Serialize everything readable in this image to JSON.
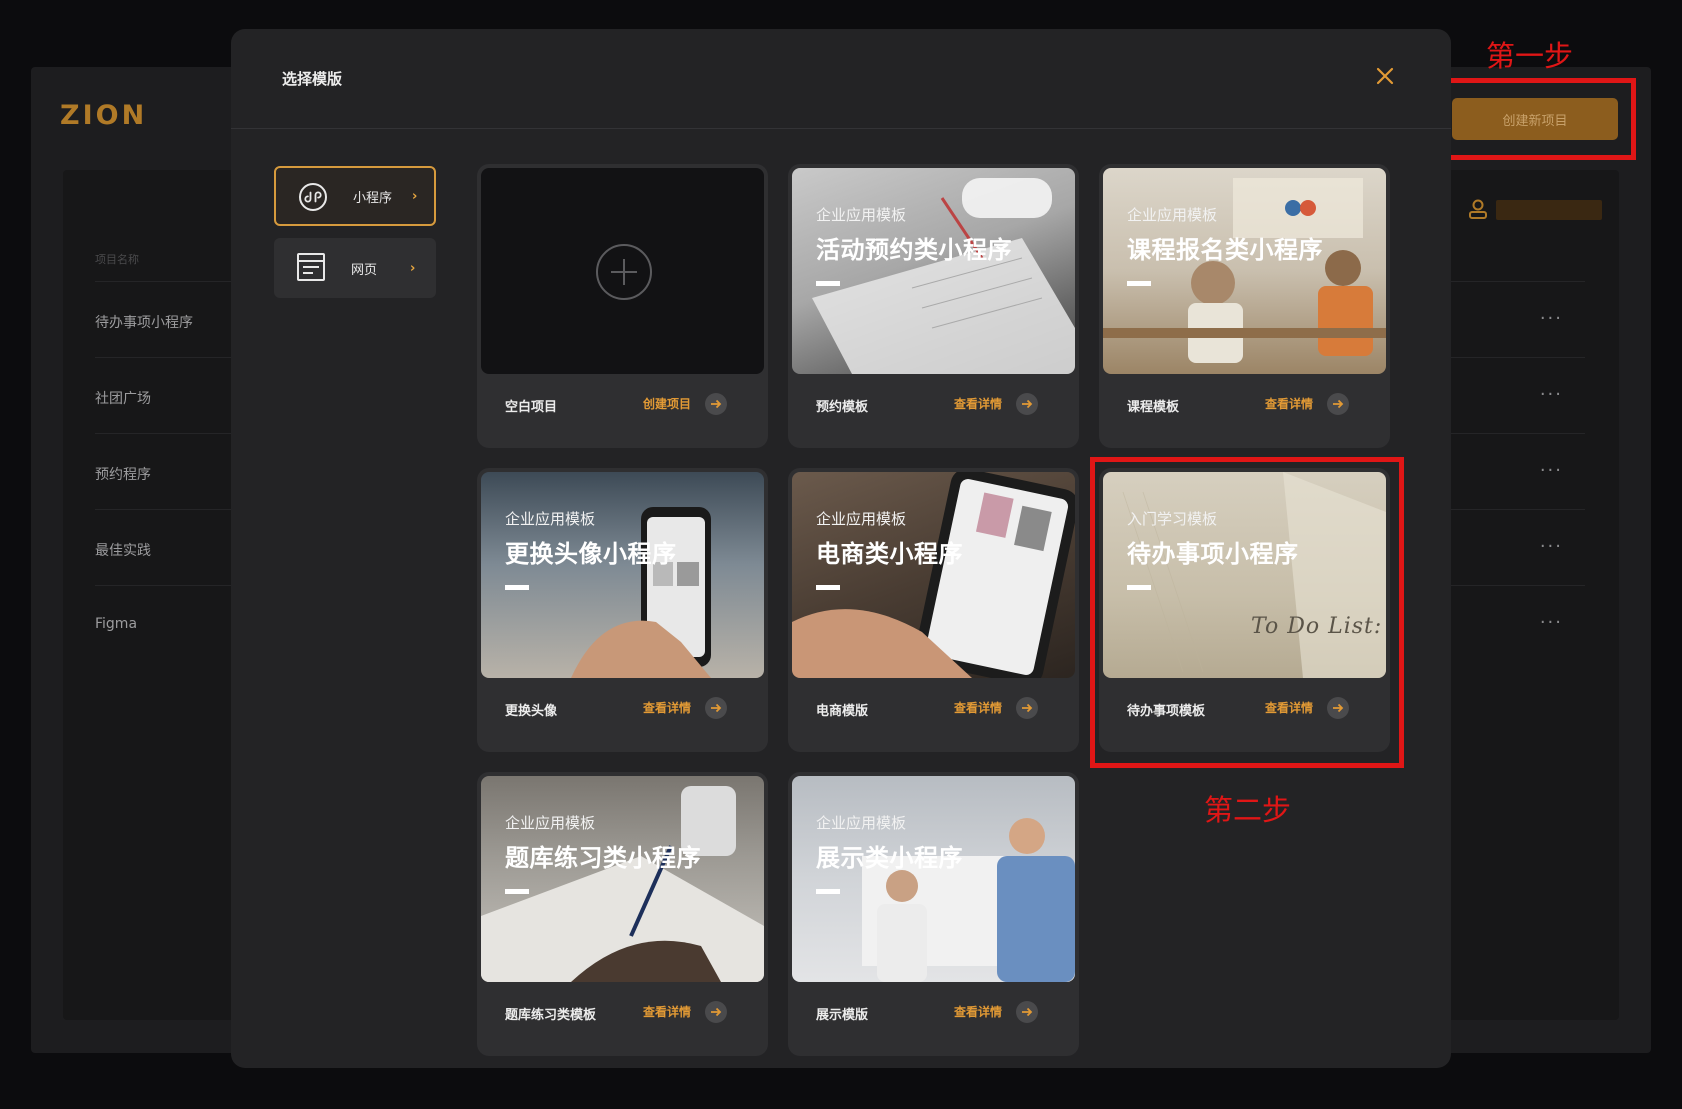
{
  "background": {
    "logo": "ZION",
    "table_header": "项目名称",
    "rows": [
      "待办事项小程序",
      "社团广场",
      "预约程序",
      "最佳实践",
      "Figma"
    ],
    "more": "···",
    "create_button": "创建新项目"
  },
  "annotations": {
    "step1": "第一步",
    "step2": "第二步",
    "color": "#e01616"
  },
  "modal": {
    "title": "选择模版",
    "close_icon": "close-icon",
    "nav": [
      {
        "label": "小程序",
        "icon": "mini-program-icon",
        "active": true
      },
      {
        "label": "网页",
        "icon": "webpage-icon",
        "active": false
      }
    ],
    "cards": [
      {
        "type": "blank",
        "footer": "空白项目",
        "link": "创建项目"
      },
      {
        "tag": "企业应用模板",
        "name": "活动预约类小程序",
        "footer": "预约模板",
        "link": "查看详情"
      },
      {
        "tag": "企业应用模板",
        "name": "课程报名类小程序",
        "footer": "课程模板",
        "link": "查看详情"
      },
      {
        "tag": "企业应用模板",
        "name": "更换头像小程序",
        "footer": "更换头像",
        "link": "查看详情"
      },
      {
        "tag": "企业应用模板",
        "name": "电商类小程序",
        "footer": "电商模版",
        "link": "查看详情"
      },
      {
        "tag": "入门学习模板",
        "name": "待办事项小程序",
        "footer": "待办事项模板",
        "link": "查看详情",
        "image_text": "To Do List:"
      },
      {
        "tag": "企业应用模板",
        "name": "题库练习类小程序",
        "footer": "题库练习类模板",
        "link": "查看详情"
      },
      {
        "tag": "企业应用模板",
        "name": "展示类小程序",
        "footer": "展示模版",
        "link": "查看详情"
      }
    ]
  },
  "colors": {
    "accent": "#e29a35",
    "brand": "#b07a27"
  }
}
